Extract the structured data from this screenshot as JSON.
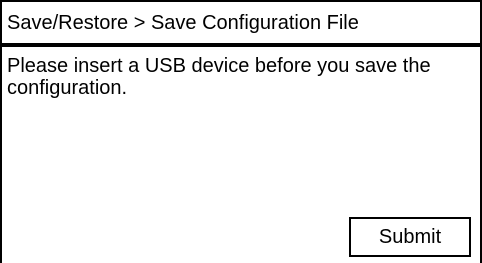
{
  "header": {
    "breadcrumb": "Save/Restore > Save Configuration File"
  },
  "main": {
    "message_line1": "Please insert a USB device before you save the",
    "message_line2": "configuration."
  },
  "actions": {
    "submit_label": "Submit"
  }
}
